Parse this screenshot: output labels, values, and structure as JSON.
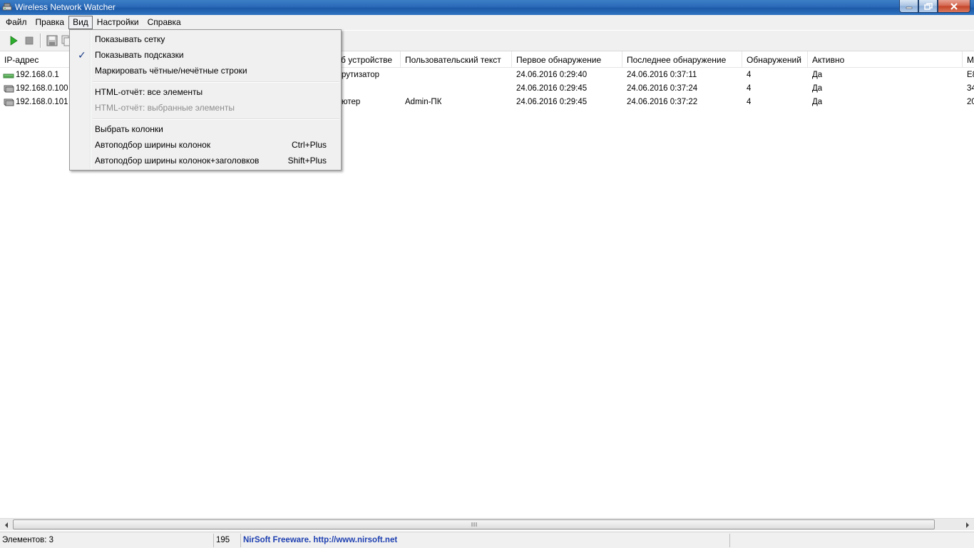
{
  "window": {
    "title": "Wireless Network Watcher",
    "icon": "network-card-icon"
  },
  "menubar": {
    "items": [
      {
        "label": "Файл"
      },
      {
        "label": "Правка"
      },
      {
        "label": "Вид"
      },
      {
        "label": "Настройки"
      },
      {
        "label": "Справка"
      }
    ],
    "active": "Вид"
  },
  "toolbar": {
    "buttons": [
      "play-icon",
      "stop-icon",
      "save-icon",
      "copy-icon"
    ]
  },
  "dropdown": {
    "items": [
      {
        "label": "Показывать сетку",
        "checked": false
      },
      {
        "label": "Показывать подсказки",
        "checked": true
      },
      {
        "label": "Маркировать чётные/нечётные строки",
        "checked": false
      },
      {
        "label": "HTML-отчёт: все элементы",
        "checked": false
      },
      {
        "label": "HTML-отчёт: выбранные элементы",
        "disabled": true
      },
      {
        "label": "Выбрать колонки"
      },
      {
        "label": "Автоподбор ширины колонок",
        "shortcut": "Ctrl+Plus"
      },
      {
        "label": "Автоподбор ширины колонок+заголовков",
        "shortcut": "Shift+Plus"
      }
    ]
  },
  "table": {
    "columns": [
      {
        "label": "IP-адрес"
      },
      {
        "label": "б устройстве"
      },
      {
        "label": "Пользовательский текст"
      },
      {
        "label": "Первое обнаружение"
      },
      {
        "label": "Последнее обнаружение"
      },
      {
        "label": "Обнаружений"
      },
      {
        "label": "Активно"
      },
      {
        "label": "М"
      }
    ],
    "rows": [
      {
        "ip": "192.168.0.1",
        "icon": "router-icon",
        "device": "рутизатор",
        "user_text": "",
        "first": "24.06.2016 0:29:40",
        "last": "24.06.2016 0:37:11",
        "count": "4",
        "active": "Да",
        "extra": "E8"
      },
      {
        "ip": "192.168.0.100",
        "icon": "computer-icon",
        "device": "",
        "user_text": "",
        "first": "24.06.2016 0:29:45",
        "last": "24.06.2016 0:37:24",
        "count": "4",
        "active": "Да",
        "extra": "34"
      },
      {
        "ip": "192.168.0.101",
        "icon": "computer-icon",
        "device": "ютер",
        "user_text": "Admin-ПК",
        "first": "24.06.2016 0:29:45",
        "last": "24.06.2016 0:37:22",
        "count": "4",
        "active": "Да",
        "extra": "20"
      }
    ]
  },
  "statusbar": {
    "items_count": "Элементов: 3",
    "number": "195",
    "link": "NirSoft Freeware.  http://www.nirsoft.net"
  },
  "colors": {
    "titlebar": "#2a69b8",
    "link": "#1d3fb0",
    "check": "#1c3c88"
  }
}
